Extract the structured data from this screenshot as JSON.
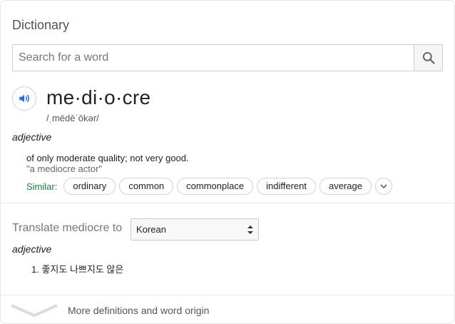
{
  "header": {
    "title": "Dictionary"
  },
  "search": {
    "placeholder": "Search for a word",
    "value": ""
  },
  "entry": {
    "word": "me·di·o·cre",
    "pronunciation": "/ˌmēdēˈōkər/",
    "part_of_speech": "adjective",
    "definition": "of only moderate quality; not very good.",
    "example": "\"a mediocre actor\"",
    "similar_label": "Similar:",
    "similar": [
      "ordinary",
      "common",
      "commonplace",
      "indifferent",
      "average"
    ]
  },
  "translate": {
    "label": "Translate mediocre to",
    "language": "Korean",
    "part_of_speech": "adjective",
    "items": [
      "1. 좋지도 나쁘지도 않은"
    ]
  },
  "footer": {
    "more_label": "More definitions and word origin"
  },
  "colors": {
    "accent": "#1a73e8",
    "similar_label": "#188038"
  },
  "icons": {
    "search": "search-icon",
    "speaker": "speaker-icon",
    "expand": "chevron-down-icon",
    "select": "updown-arrows-icon",
    "more": "chevron-down-icon"
  }
}
